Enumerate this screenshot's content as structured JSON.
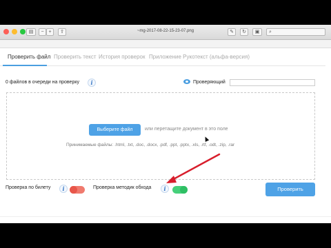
{
  "window": {
    "title": "~mg-2017-08-22-15-23-07.png",
    "traffic_colors": [
      "#fc5f57",
      "#fdbc2e",
      "#27c840"
    ]
  },
  "tabs": [
    {
      "label": "Проверить файл",
      "active": true
    },
    {
      "label": "Проверить текст",
      "active": false
    },
    {
      "label": "История проверок",
      "active": false
    },
    {
      "label": "Приложение Рукотекст (альфа-версия)",
      "active": false
    }
  ],
  "queue": {
    "label": "0 файлов в очереди на проверку"
  },
  "reviewer": {
    "label": "Проверяющий",
    "value": ""
  },
  "dropzone": {
    "choose_label": "Выберите файл",
    "drag_text": "или перетащите документ в это поле",
    "accepted_text": "Принимаемые файлы: .html, .txt, .doc, .docx, .pdf, .ppt, .pptx, .xls, .rtf, .odt, .zip, .rar"
  },
  "options": {
    "ticket_check": {
      "label": "Проверка по билету",
      "enabled": false
    },
    "bypass_check": {
      "label": "Проверка методик обхода",
      "enabled": true
    }
  },
  "submit_label": "Проверить",
  "info_glyph": "i",
  "colors": {
    "accent": "#4ea2e6",
    "toggle_off": "#f07a6e",
    "toggle_on": "#46d07a",
    "arrow": "#d81e2c"
  }
}
